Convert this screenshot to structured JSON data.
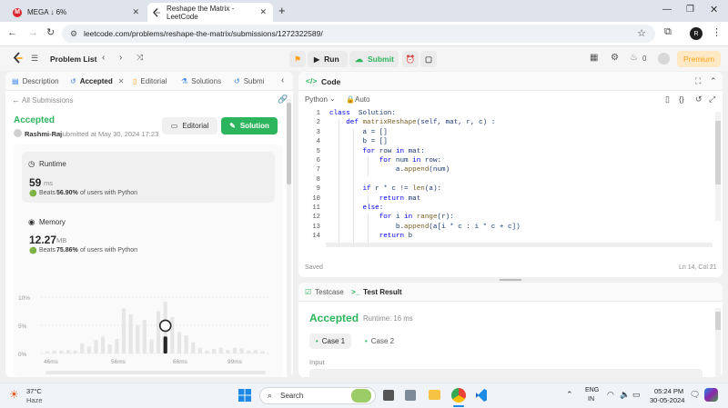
{
  "browser": {
    "tabs": [
      {
        "title": "MEGA ↓ 6%",
        "active": false
      },
      {
        "title": "Reshape the Matrix - LeetCode",
        "active": true
      }
    ],
    "url": "leetcode.com/problems/reshape-the-matrix/submissions/1272322589/",
    "profile_initial": "R"
  },
  "lc_header": {
    "problem_list": "Problem List",
    "run": "Run",
    "submit": "Submit",
    "fire_count": "0",
    "premium": "Premium"
  },
  "left": {
    "tabs": [
      "Description",
      "Accepted",
      "Editorial",
      "Solutions",
      "Submi"
    ],
    "back_link": "All Submissions",
    "status": "Accepted",
    "author": "Rashmi-Raj",
    "submitted_text": "submitted at May 30, 2024 17:23",
    "editorial_btn": "Editorial",
    "solution_btn": "Solution",
    "runtime": {
      "label": "Runtime",
      "value": "59",
      "unit": "ms",
      "beats_prefix": "Beats",
      "beats": "56.90%",
      "beats_suffix": "of users with Python"
    },
    "memory": {
      "label": "Memory",
      "value": "12.27",
      "unit": "MB",
      "beats_prefix": "Beats",
      "beats": "75.86%",
      "beats_suffix": "of users with Python"
    }
  },
  "chart_data": {
    "type": "bar",
    "y_ticks": [
      "10%",
      "5%",
      "0%"
    ],
    "ylim": [
      0,
      10
    ],
    "x_ticks": [
      "46ms",
      "56ms",
      "66ms",
      "99ms"
    ],
    "values": [
      0.4,
      0.5,
      0.5,
      0.6,
      0.5,
      1.8,
      1.2,
      2.4,
      3.0,
      1.6,
      2.6,
      8.0,
      7.0,
      5.0,
      6.0,
      2.5,
      7.5,
      9.2,
      6.5,
      3.8,
      3.2,
      2.0,
      1.0,
      0.5,
      0.8,
      1.0,
      0.6,
      1.0,
      0.9,
      0.5,
      0.6,
      0.4
    ],
    "highlight_index": 17,
    "highlight_value": 3.0
  },
  "code": {
    "language": "Python",
    "mode": "Auto",
    "lines": [
      [
        [
          "kw",
          "class"
        ],
        [
          "",
          "  Solution:"
        ]
      ],
      [
        [
          "",
          "    "
        ],
        [
          "kw",
          "def"
        ],
        [
          "fn",
          " matrixReshape"
        ],
        [
          "",
          "(self, mat, r, c) :"
        ]
      ],
      [
        [
          "",
          "        a = []"
        ]
      ],
      [
        [
          "",
          "        b = []"
        ]
      ],
      [
        [
          "",
          "        "
        ],
        [
          "kw",
          "for"
        ],
        [
          "",
          " row "
        ],
        [
          "kw",
          "in"
        ],
        [
          "",
          " mat:"
        ]
      ],
      [
        [
          "",
          "            "
        ],
        [
          "kw",
          "for"
        ],
        [
          "",
          " num "
        ],
        [
          "kw",
          "in"
        ],
        [
          "",
          " row:"
        ]
      ],
      [
        [
          "",
          "                a."
        ],
        [
          "fn",
          "append"
        ],
        [
          "",
          "(num)"
        ]
      ],
      [
        [
          "",
          ""
        ]
      ],
      [
        [
          "",
          "        "
        ],
        [
          "kw",
          "if"
        ],
        [
          "",
          " r * c != "
        ],
        [
          "fn",
          "len"
        ],
        [
          "",
          "(a):"
        ]
      ],
      [
        [
          "",
          "            "
        ],
        [
          "kw",
          "return"
        ],
        [
          "",
          " mat"
        ]
      ],
      [
        [
          "",
          "        "
        ],
        [
          "kw",
          "else"
        ],
        [
          "",
          ":"
        ]
      ],
      [
        [
          "",
          "            "
        ],
        [
          "kw",
          "for"
        ],
        [
          "",
          " i "
        ],
        [
          "kw",
          "in"
        ],
        [
          "",
          " "
        ],
        [
          "fn",
          "range"
        ],
        [
          "",
          "(r):"
        ]
      ],
      [
        [
          "",
          "                b."
        ],
        [
          "fn",
          "append"
        ],
        [
          "",
          "(a[i * c : i * c + c])"
        ]
      ],
      [
        [
          "",
          "            "
        ],
        [
          "kw",
          "return"
        ],
        [
          "",
          " b"
        ]
      ]
    ],
    "line_numbers": [
      "1",
      "2",
      "3",
      "4",
      "5",
      "6",
      "7",
      "8",
      "9",
      "10",
      "11",
      "12",
      "13",
      "14"
    ],
    "saved": "Saved",
    "cursor": "Ln 14, Col 21"
  },
  "result": {
    "tab_testcase": "Testcase",
    "tab_result": "Test Result",
    "status": "Accepted",
    "runtime": "Runtime: 16 ms",
    "case1": "Case 1",
    "case2": "Case 2",
    "input_label": "Input"
  },
  "taskbar": {
    "temp": "37°C",
    "weather": "Haze",
    "search": "Search",
    "lang1": "ENG",
    "lang2": "IN",
    "time": "05:24 PM",
    "date": "30-05-2024"
  },
  "colors": {
    "accent_green": "#2db55d",
    "premium_orange": "#ffa116",
    "chart_bar": "#e6e6e6",
    "chart_highlight": "#262626"
  }
}
